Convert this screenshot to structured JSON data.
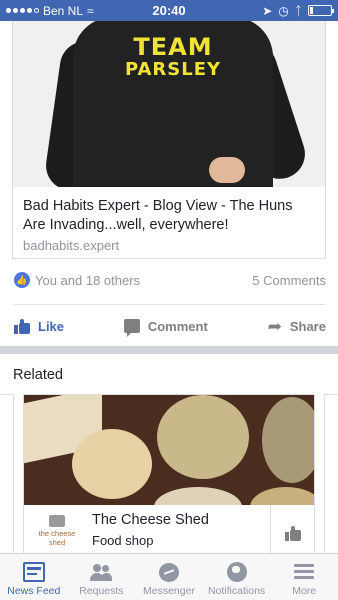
{
  "status_bar": {
    "carrier": "Ben NL",
    "time": "20:40",
    "battery_level": 0.15
  },
  "post": {
    "image": {
      "shirt_text_line1": "TEAM",
      "shirt_text_line2": "PARSLEY",
      "shirt_text_color": "#f1e334"
    },
    "link_title": "Bad Habits Expert - Blog View - The Huns Are Invading...well, everywhere!",
    "link_domain": "badhabits.expert",
    "reactions_text": "You and 18 others",
    "comments_text": "5 Comments",
    "actions": {
      "like": "Like",
      "comment": "Comment",
      "share": "Share"
    }
  },
  "related": {
    "heading": "Related",
    "card": {
      "logo_text": "the cheese shed",
      "name": "The Cheese Shed",
      "category": "Food shop"
    }
  },
  "tab_bar": {
    "tabs": [
      {
        "label": "News Feed",
        "icon": "news-feed-icon",
        "active": true
      },
      {
        "label": "Requests",
        "icon": "friend-requests-icon",
        "active": false
      },
      {
        "label": "Messenger",
        "icon": "messenger-icon",
        "active": false
      },
      {
        "label": "Notifications",
        "icon": "globe-icon",
        "active": false
      },
      {
        "label": "More",
        "icon": "menu-icon",
        "active": false
      }
    ]
  },
  "colors": {
    "brand": "#4267b2",
    "like_badge": "#4a76e4",
    "muted_text": "#90949c"
  }
}
